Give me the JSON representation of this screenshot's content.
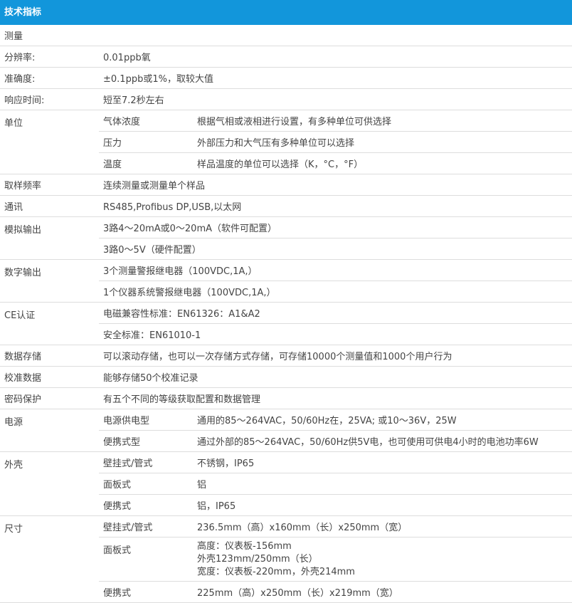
{
  "header": {
    "title": "技术指标"
  },
  "measurement": {
    "title": "测量"
  },
  "resolution": {
    "label": "分辨率:",
    "value": "0.01ppb氧"
  },
  "accuracy": {
    "label": "准确度:",
    "value": "±0.1ppb或1%，取较大值"
  },
  "response": {
    "label": "响应时间:",
    "value": "短至7.2秒左右"
  },
  "units": {
    "label": "单位",
    "items": [
      {
        "name": "气体浓度",
        "value": "根据气相或液相进行设置，有多种单位可供选择"
      },
      {
        "name": "压力",
        "value": "外部压力和大气压有多种单位可以选择"
      },
      {
        "name": "温度",
        "value": "样品温度的单位可以选择（K，°C，°F）"
      }
    ]
  },
  "sampling": {
    "label": "取样频率",
    "value": "连续测量或测量单个样品"
  },
  "comm": {
    "label": "通讯",
    "value": "RS485,Profibus DP,USB,以太网"
  },
  "analog": {
    "label": "模拟输出",
    "values": [
      "3路4～20mA或0～20mA（软件可配置）",
      "3路0～5V（硬件配置）"
    ]
  },
  "digital": {
    "label": "数字输出",
    "values": [
      "3个测量警报继电器（100VDC,1A,）",
      "1个仪器系统警报继电器（100VDC,1A,）"
    ]
  },
  "ce": {
    "label": "CE认证",
    "values": [
      "电磁兼容性标准：EN61326：A1&A2",
      "安全标准：EN61010-1"
    ]
  },
  "storage": {
    "label": "数据存储",
    "value": "可以滚动存储，也可以一次存储方式存储，可存储10000个测量值和1000个用户行为"
  },
  "calib": {
    "label": "校准数据",
    "value": "能够存储50个校准记录"
  },
  "password": {
    "label": "密码保护",
    "value": "有五个不同的等级获取配置和数据管理"
  },
  "power": {
    "label": "电源",
    "items": [
      {
        "name": "电源供电型",
        "value": "通用的85～264VAC，50/60Hz在，25VA; 或10～36V，25W"
      },
      {
        "name": "便携式型",
        "value": "通过外部的85～264VAC，50/60Hz供5V电，也可使用可供电4小时的电池功率6W"
      }
    ]
  },
  "housing": {
    "label": "外壳",
    "items": [
      {
        "name": "壁挂式/管式",
        "value": "不锈钢，IP65"
      },
      {
        "name": "面板式",
        "value": "铝"
      },
      {
        "name": "便携式",
        "value": "铝，IP65"
      }
    ]
  },
  "size": {
    "label": "尺寸",
    "items": [
      {
        "name": "壁挂式/管式",
        "value": "236.5mm（高）x160mm（长）x250mm（宽）"
      },
      {
        "name": "面板式",
        "lines": [
          "高度：仪表板-156mm",
          "外壳123mm/250mm（长）",
          "宽度：仪表板-220mm，外壳214mm"
        ]
      },
      {
        "name": "便携式",
        "value": "225mm（高）x250mm（长）x219mm（宽）"
      }
    ]
  }
}
